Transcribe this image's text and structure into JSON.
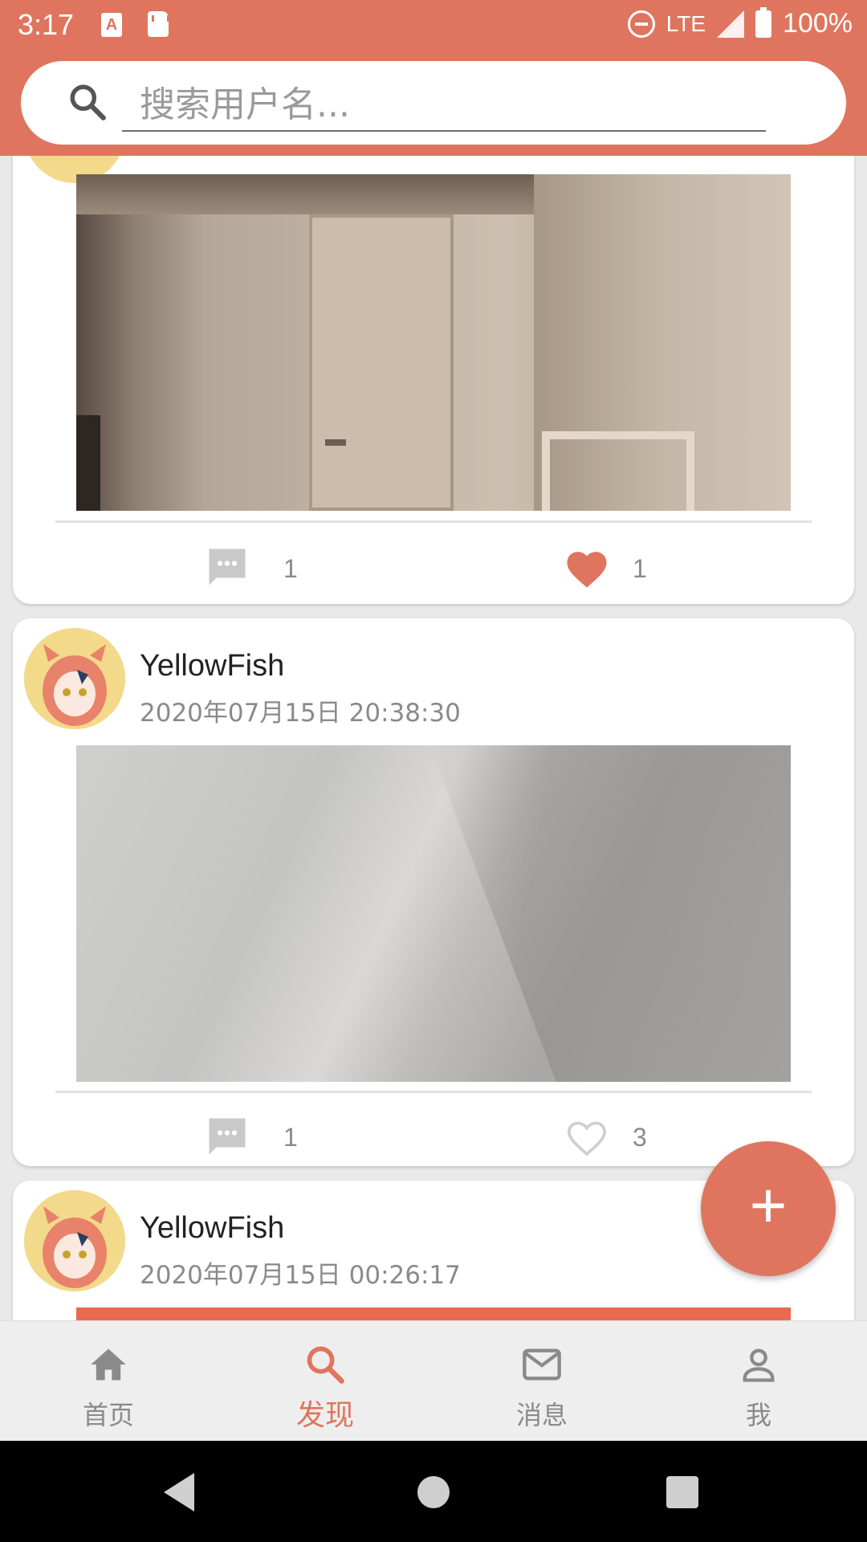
{
  "status_bar": {
    "time": "3:17",
    "network": "LTE",
    "battery": "100%"
  },
  "search": {
    "placeholder": "搜索用户名..."
  },
  "posts": [
    {
      "comment_count": "1",
      "like_count": "1",
      "liked": true
    },
    {
      "username": "YellowFish",
      "timestamp": "2020年07月15日 20:38:30",
      "comment_count": "1",
      "like_count": "3",
      "liked": false
    },
    {
      "username": "YellowFish",
      "timestamp": "2020年07月15日 00:26:17"
    }
  ],
  "fab": {
    "label": "+"
  },
  "bottom_nav": {
    "items": [
      {
        "label": "首页",
        "icon": "home-icon"
      },
      {
        "label": "发现",
        "icon": "search-icon"
      },
      {
        "label": "消息",
        "icon": "mail-icon"
      },
      {
        "label": "我",
        "icon": "person-icon"
      }
    ],
    "active_index": 1
  },
  "colors": {
    "accent": "#df755e",
    "inactive": "#8a8a8a",
    "liked_heart": "#df755e"
  }
}
